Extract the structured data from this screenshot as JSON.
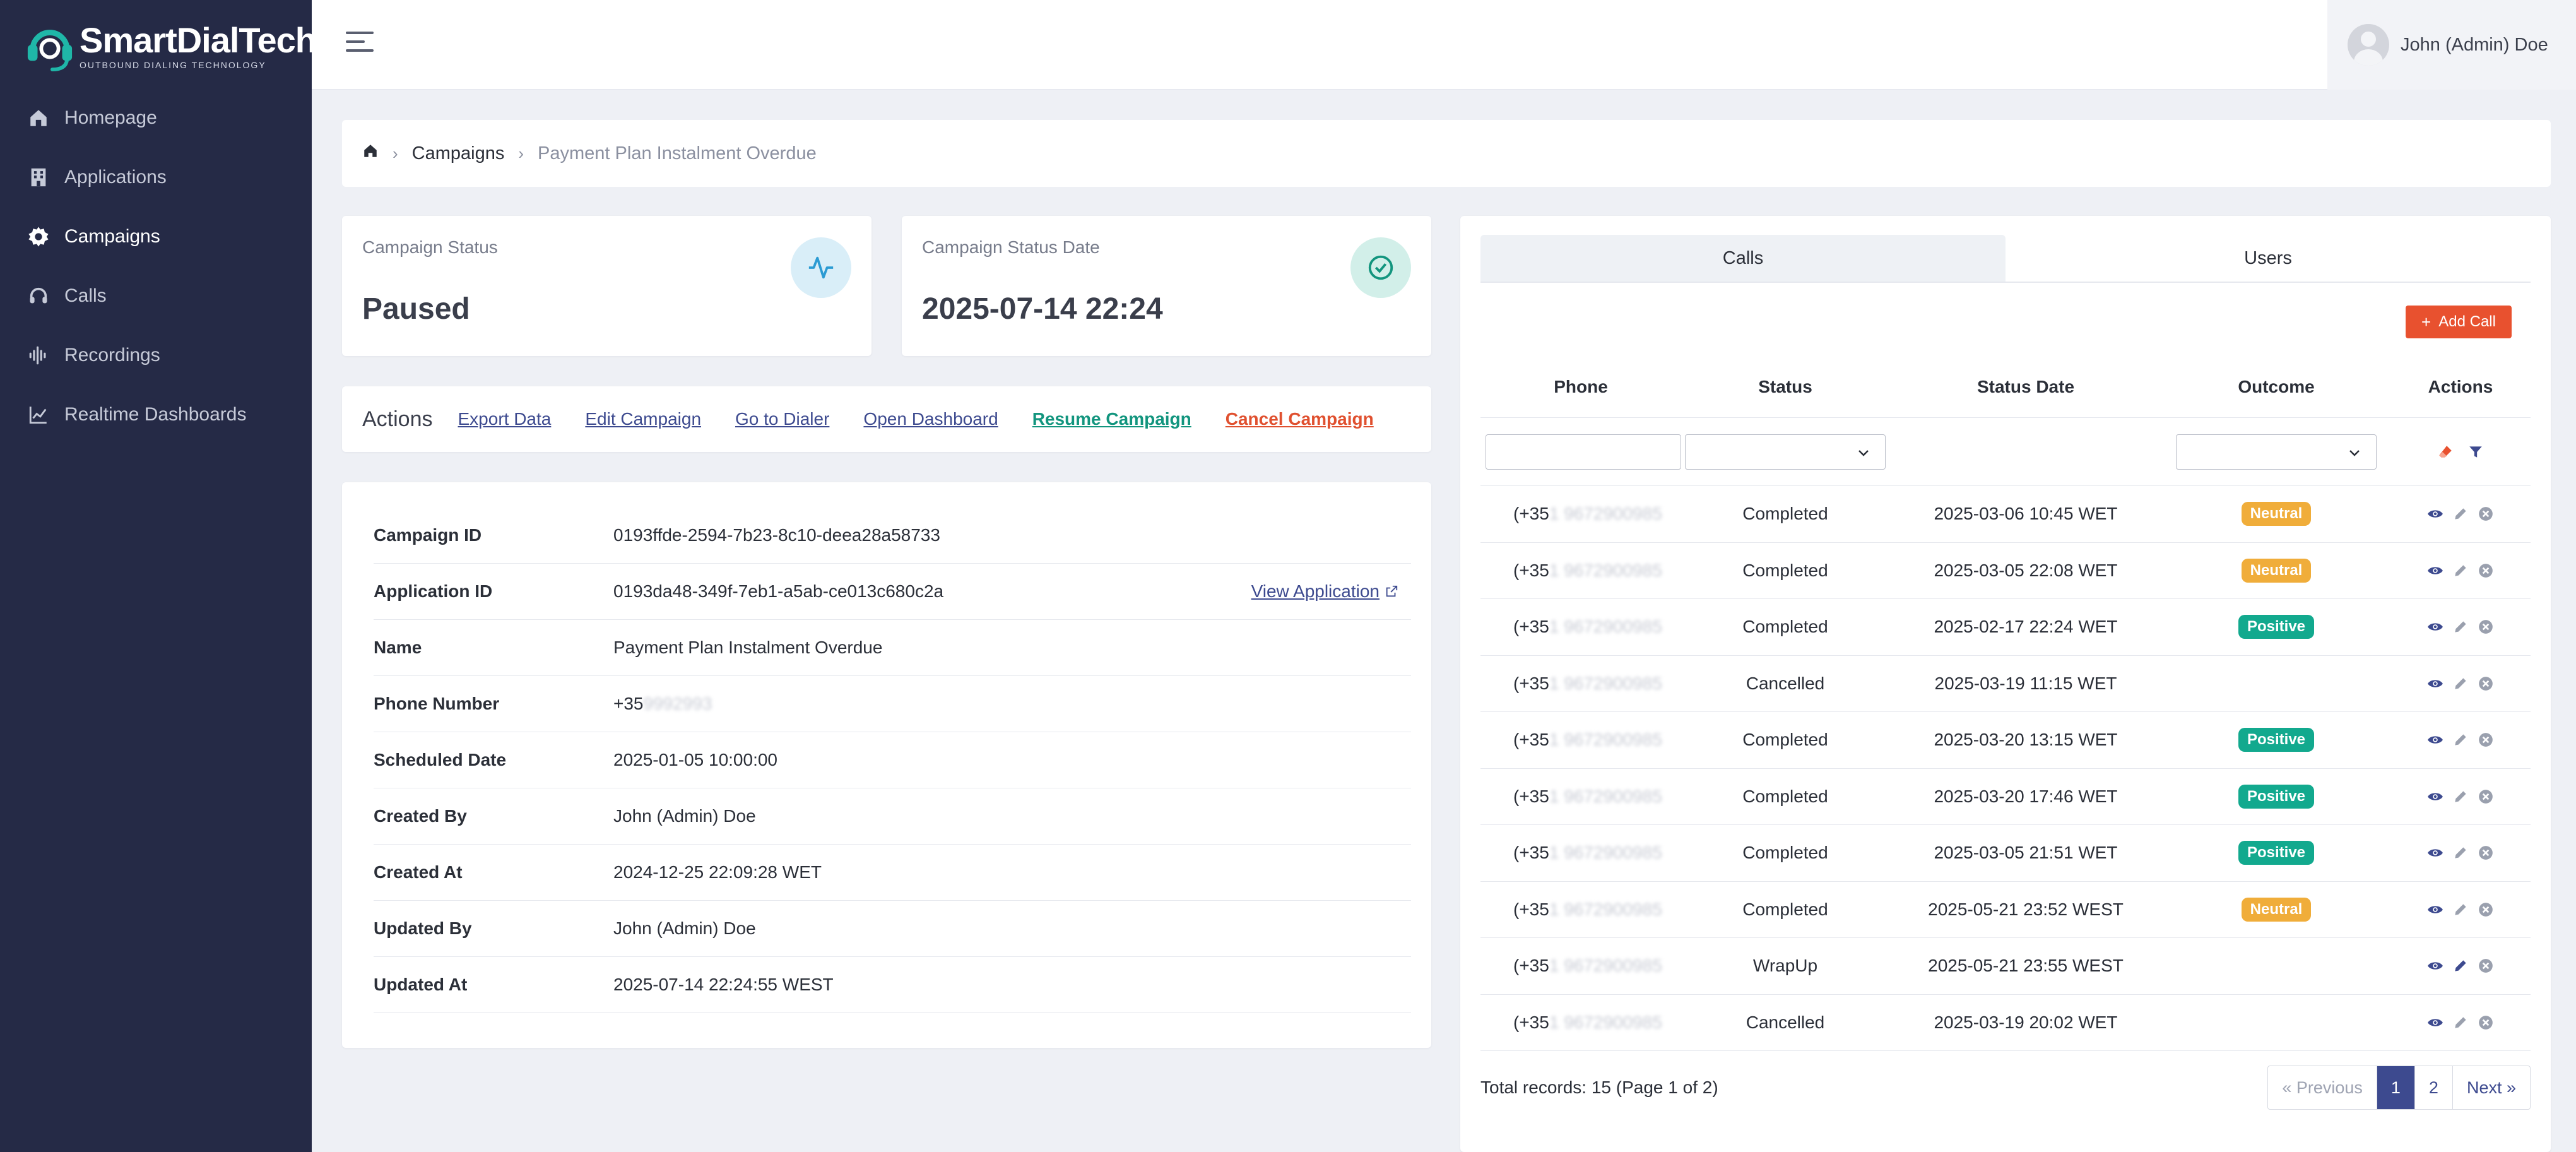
{
  "brand": {
    "name": "SmartDialTech",
    "tagline": "OUTBOUND DIALING TECHNOLOGY",
    "accent": "#1fb7a8"
  },
  "sidebar": {
    "items": [
      {
        "label": "Homepage",
        "icon": "home-icon",
        "active": false
      },
      {
        "label": "Applications",
        "icon": "building-icon",
        "active": false
      },
      {
        "label": "Campaigns",
        "icon": "gear-icon",
        "active": true
      },
      {
        "label": "Calls",
        "icon": "headset-icon",
        "active": false
      },
      {
        "label": "Recordings",
        "icon": "waveform-icon",
        "active": false
      },
      {
        "label": "Realtime Dashboards",
        "icon": "chart-line-icon",
        "active": false
      }
    ]
  },
  "topbar": {
    "user_name": "John (Admin) Doe"
  },
  "breadcrumb": {
    "parent": "Campaigns",
    "current": "Payment Plan Instalment Overdue"
  },
  "status_cards": {
    "status": {
      "label": "Campaign Status",
      "value": "Paused"
    },
    "status_date": {
      "label": "Campaign Status Date",
      "value": "2025-07-14 22:24"
    }
  },
  "actions": {
    "title": "Actions",
    "export": "Export Data",
    "edit": "Edit Campaign",
    "dialer": "Go to Dialer",
    "dashboard": "Open Dashboard",
    "resume": "Resume Campaign",
    "cancel": "Cancel Campaign"
  },
  "details": {
    "view_application": "View Application",
    "rows": [
      {
        "label": "Campaign ID",
        "value": "0193ffde-2594-7b23-8c10-deea28a58733"
      },
      {
        "label": "Application ID",
        "value": "0193da48-349f-7eb1-a5ab-ce013c680c2a"
      },
      {
        "label": "Name",
        "value": "Payment Plan Instalment Overdue"
      },
      {
        "label": "Phone Number",
        "value": "+35",
        "masked": "9992993"
      },
      {
        "label": "Scheduled Date",
        "value": "2025-01-05 10:00:00"
      },
      {
        "label": "Created By",
        "value": "John (Admin) Doe"
      },
      {
        "label": "Created At",
        "value": "2024-12-25 22:09:28 WET"
      },
      {
        "label": "Updated By",
        "value": "John (Admin) Doe"
      },
      {
        "label": "Updated At",
        "value": "2025-07-14 22:24:55 WEST"
      }
    ]
  },
  "calls_panel": {
    "tabs": [
      {
        "label": "Calls",
        "active": true
      },
      {
        "label": "Users",
        "active": false
      }
    ],
    "add_call": "Add Call",
    "columns": {
      "phone": "Phone",
      "status": "Status",
      "status_date": "Status Date",
      "outcome": "Outcome",
      "actions": "Actions"
    },
    "rows": [
      {
        "phone": "(+35",
        "masked": "1 9672900985",
        "status": "Completed",
        "date": "2025-03-06 10:45 WET",
        "outcome": "Neutral"
      },
      {
        "phone": "(+35",
        "masked": "1 9672900985",
        "status": "Completed",
        "date": "2025-03-05 22:08 WET",
        "outcome": "Neutral"
      },
      {
        "phone": "(+35",
        "masked": "1 9672900985",
        "status": "Completed",
        "date": "2025-02-17 22:24 WET",
        "outcome": "Positive"
      },
      {
        "phone": "(+35",
        "masked": "1 9672900985",
        "status": "Cancelled",
        "date": "2025-03-19 11:15 WET",
        "outcome": ""
      },
      {
        "phone": "(+35",
        "masked": "1 9672900985",
        "status": "Completed",
        "date": "2025-03-20 13:15 WET",
        "outcome": "Positive"
      },
      {
        "phone": "(+35",
        "masked": "1 9672900985",
        "status": "Completed",
        "date": "2025-03-20 17:46 WET",
        "outcome": "Positive"
      },
      {
        "phone": "(+35",
        "masked": "1 9672900985",
        "status": "Completed",
        "date": "2025-03-05 21:51 WET",
        "outcome": "Positive"
      },
      {
        "phone": "(+35",
        "masked": "1 9672900985",
        "status": "Completed",
        "date": "2025-05-21 23:52 WEST",
        "outcome": "Neutral"
      },
      {
        "phone": "(+35",
        "masked": "1 9672900985",
        "status": "WrapUp",
        "date": "2025-05-21 23:55 WEST",
        "outcome": ""
      },
      {
        "phone": "(+35",
        "masked": "1 9672900985",
        "status": "Cancelled",
        "date": "2025-03-19 20:02 WET",
        "outcome": ""
      }
    ],
    "total": "Total records: 15 (Page 1 of 2)",
    "pagination": {
      "previous": "« Previous",
      "pages": [
        "1",
        "2"
      ],
      "current": "1",
      "next": "Next »"
    }
  },
  "colors": {
    "sidebar_bg": "#252a46",
    "primary": "#3d4a8f",
    "danger": "#e8512f",
    "success": "#12957e",
    "neutral_badge": "#f0ad3a",
    "positive_badge": "#12a98e"
  }
}
